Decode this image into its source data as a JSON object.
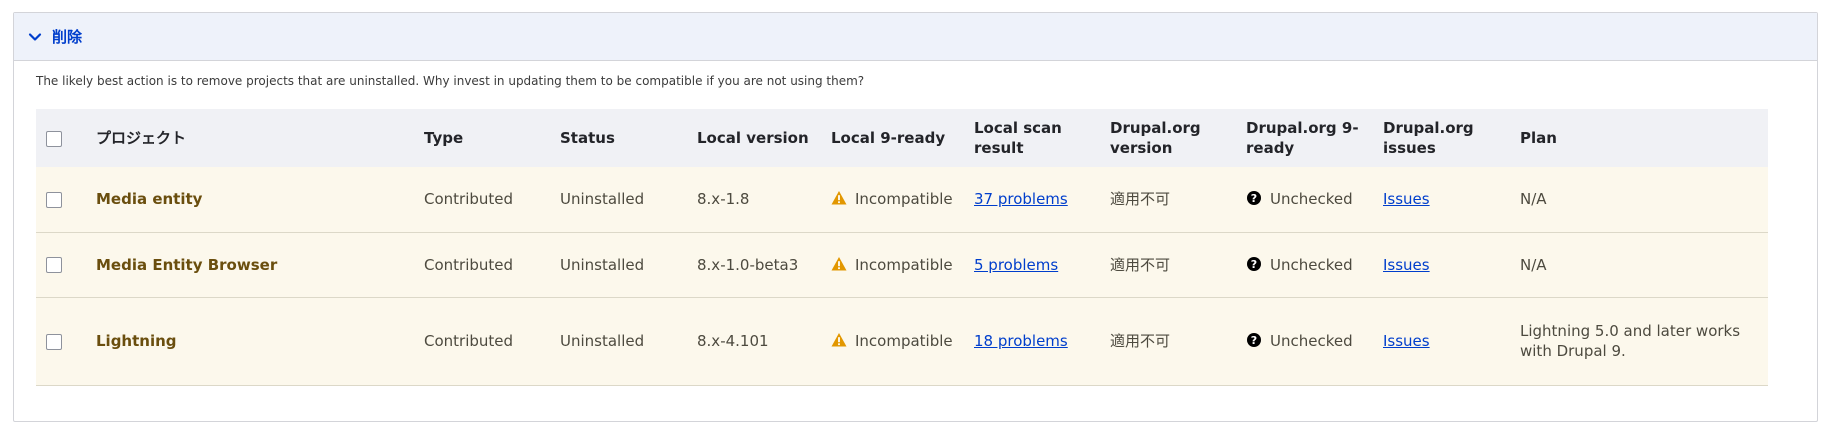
{
  "section": {
    "title": "削除",
    "description": "The likely best action is to remove projects that are uninstalled. Why invest in updating them to be compatible if you are not using them?"
  },
  "table": {
    "headers": {
      "project": "プロジェクト",
      "type": "Type",
      "status": "Status",
      "local_version": "Local version",
      "local_ready": "Local 9-ready",
      "scan_result": "Local scan result",
      "org_version": "Drupal.org version",
      "org_ready": "Drupal.org 9-ready",
      "org_issues": "Drupal.org issues",
      "plan": "Plan"
    },
    "rows": [
      {
        "name": "Media entity",
        "type": "Contributed",
        "status": "Uninstalled",
        "local_version": "8.x-1.8",
        "local_ready": "Incompatible",
        "scan_result": "37 problems",
        "org_version": "適用不可",
        "org_ready": "Unchecked",
        "issues": "Issues",
        "plan": "N/A"
      },
      {
        "name": "Media Entity Browser",
        "type": "Contributed",
        "status": "Uninstalled",
        "local_version": "8.x-1.0-beta3",
        "local_ready": "Incompatible",
        "scan_result": "5 problems",
        "org_version": "適用不可",
        "org_ready": "Unchecked",
        "issues": "Issues",
        "plan": "N/A"
      },
      {
        "name": "Lightning",
        "type": "Contributed",
        "status": "Uninstalled",
        "local_version": "8.x-4.101",
        "local_ready": "Incompatible",
        "scan_result": "18 problems",
        "org_version": "適用不可",
        "org_ready": "Unchecked",
        "issues": "Issues",
        "plan": "Lightning 5.0 and later works with Drupal 9."
      }
    ]
  },
  "icons": {
    "collapse": "chevron-down-icon",
    "warning": "warning-icon",
    "unknown": "question-circle-icon"
  },
  "colors": {
    "accent": "#003ecc",
    "warning": "#e29700",
    "row_background": "#fcf8ec",
    "header_background": "#eef2fa"
  }
}
